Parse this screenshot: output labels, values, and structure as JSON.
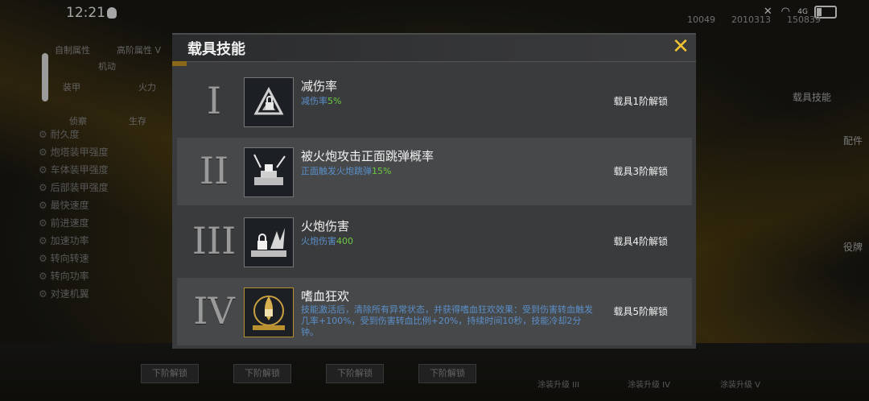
{
  "statusbar": {
    "time": "12:21",
    "network": "4G"
  },
  "background": {
    "resources": [
      "10049",
      "2010313",
      "150839"
    ],
    "left_tabs": [
      "自制属性",
      "高阶属性 V"
    ],
    "radar_labels": [
      "机动",
      "装甲",
      "火力",
      "侦察",
      "生存"
    ],
    "attrs": [
      "耐久度",
      "炮塔装甲强度",
      "车体装甲强度",
      "后部装甲强度",
      "最快速度",
      "前进速度",
      "加速功率",
      "转向转速",
      "转向功率",
      "对速机翼"
    ],
    "right_labels": [
      "载具技能",
      "配件",
      "役牌"
    ],
    "unlock_buttons": [
      "下阶解锁",
      "下阶解锁",
      "下阶解锁",
      "下阶解锁"
    ],
    "bottom_labels": [
      "涂装升级 III",
      "涂装升级 IV",
      "涂装升级 V"
    ]
  },
  "modal": {
    "title": "载具技能",
    "close_icon": "close-x-icon",
    "skills": [
      {
        "roman": "I",
        "name": "减伤率",
        "desc_prefix": "减伤率",
        "desc_value": "5%",
        "desc_suffix": "",
        "unlock": "载具1阶解锁",
        "icon": "damage-reduction-icon"
      },
      {
        "roman": "II",
        "name": "被火炮攻击正面跳弹概率",
        "desc_prefix": "正面触发火炮跳弹",
        "desc_value": "15%",
        "desc_suffix": "",
        "unlock": "载具3阶解锁",
        "icon": "ricochet-icon"
      },
      {
        "roman": "III",
        "name": "火炮伤害",
        "desc_prefix": "火炮伤害",
        "desc_value": "400",
        "desc_suffix": "",
        "unlock": "载具4阶解锁",
        "icon": "cannon-damage-icon"
      },
      {
        "roman": "IV",
        "name": "嗜血狂欢",
        "desc": "技能激活后，清除所有异常状态，并获得嗜血狂欢效果：受到伤害转血触发几率+100%，受到伤害转血比例+20%，持续时间10秒，技能冷却2分钟。",
        "unlock": "载具5阶解锁",
        "icon": "bloodlust-icon"
      }
    ]
  },
  "colors": {
    "accent": "#f1c232",
    "desc_blue": "#5b8fc9",
    "value_green": "#6ec843"
  }
}
